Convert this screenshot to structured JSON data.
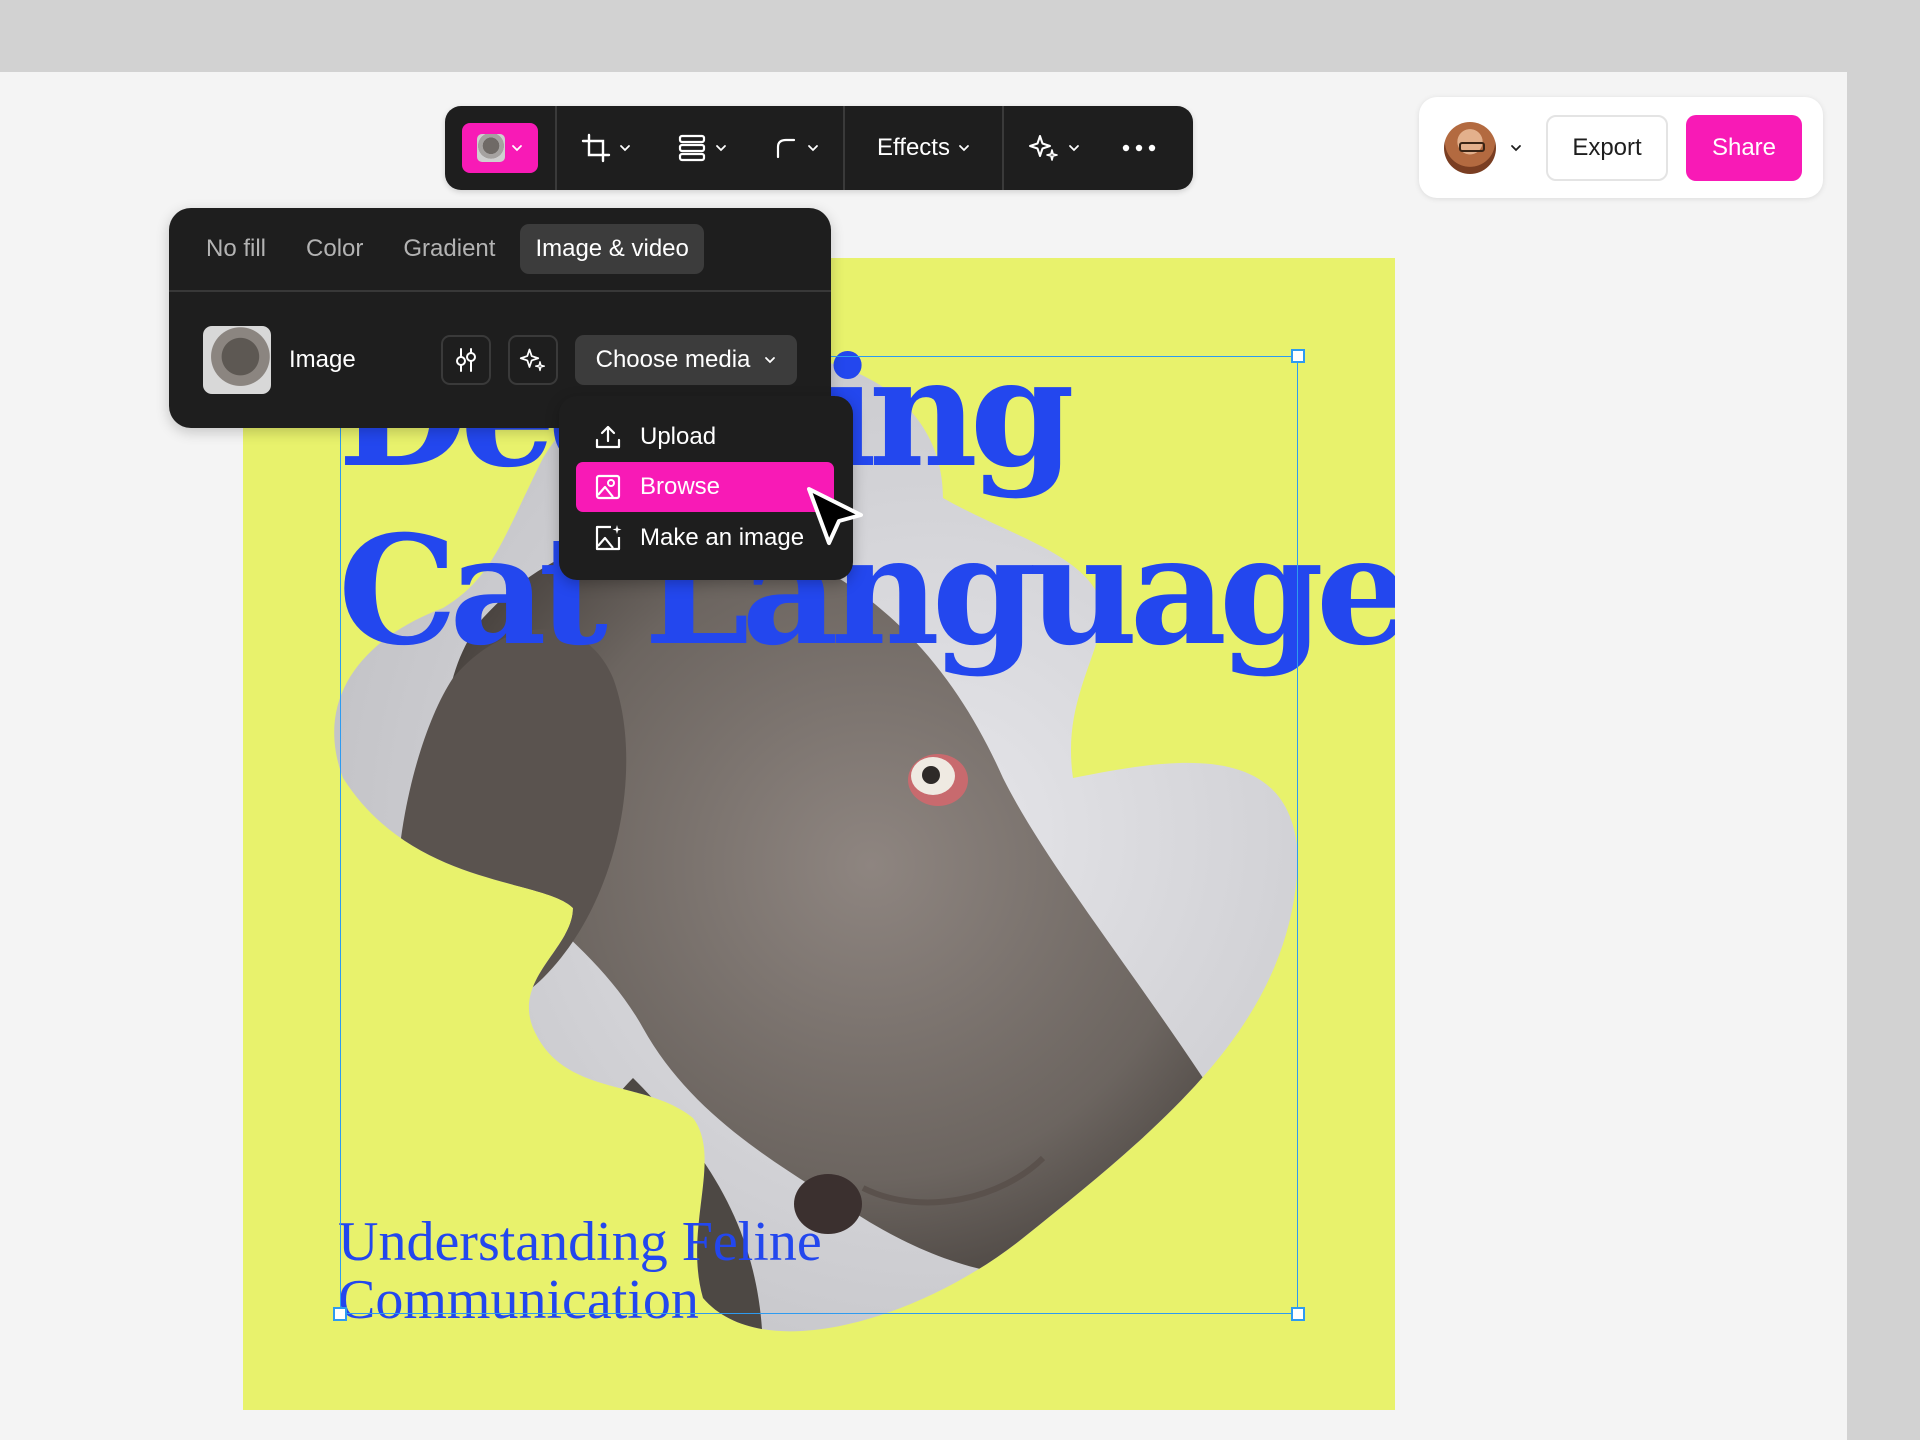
{
  "toolbar": {
    "effects_label": "Effects",
    "icons": [
      "image-fill-thumb",
      "crop-icon",
      "align-icon",
      "corner-radius-icon",
      "ai-sparkle-icon",
      "more-icon"
    ]
  },
  "share_panel": {
    "export_label": "Export",
    "share_label": "Share"
  },
  "fill_panel": {
    "tabs": [
      {
        "label": "No fill",
        "active": false
      },
      {
        "label": "Color",
        "active": false
      },
      {
        "label": "Gradient",
        "active": false
      },
      {
        "label": "Image & video",
        "active": true
      }
    ],
    "image_label": "Image",
    "choose_media_label": "Choose media"
  },
  "media_menu": {
    "items": [
      {
        "label": "Upload",
        "icon": "upload-icon",
        "selected": false
      },
      {
        "label": "Browse",
        "icon": "image-browse-icon",
        "selected": true
      },
      {
        "label": "Make an image",
        "icon": "image-generate-icon",
        "selected": false
      }
    ]
  },
  "design": {
    "headline_line1": "Decoding",
    "headline_line2": "Cat Language",
    "subhead": "Understanding Feline Communication"
  },
  "colors": {
    "accent": "#f81ab6",
    "artboard": "#e8f26c",
    "headline": "#2347ee",
    "selection": "#2e9bf0",
    "dark_ui": "#1e1e1e"
  }
}
